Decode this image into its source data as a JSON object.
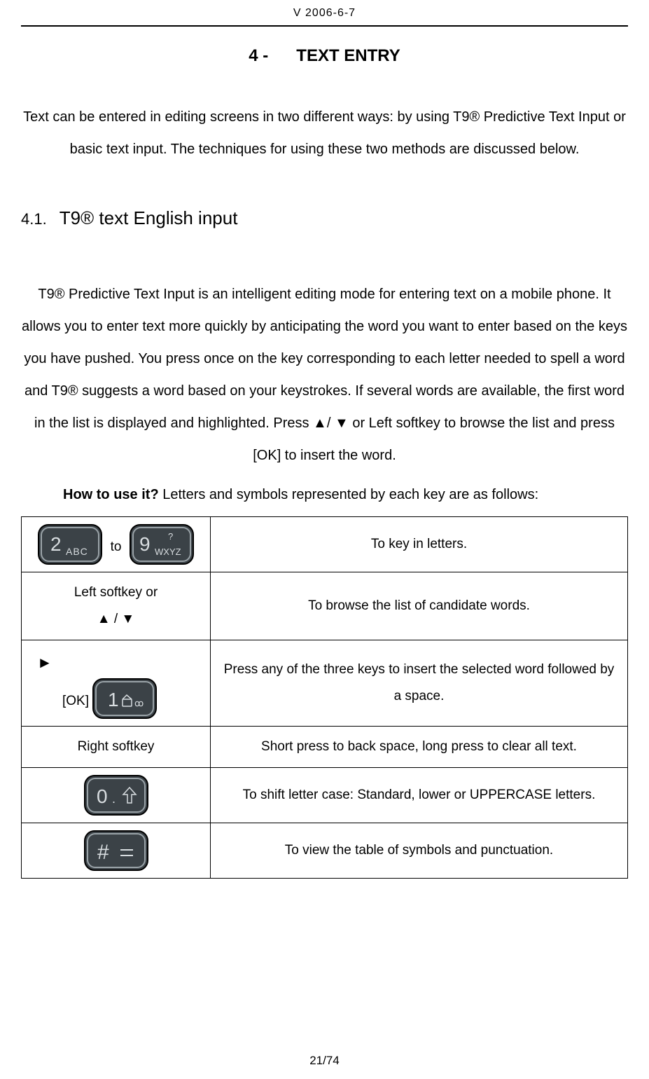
{
  "header": {
    "version": "V 2006-6-7"
  },
  "chapter": {
    "num": "4 -",
    "title": "TEXT ENTRY"
  },
  "intro": "Text can be entered in editing screens in two different ways: by using T9® Predictive Text Input or basic text input. The techniques for using these two methods are discussed below.",
  "section": {
    "num": "4.1.",
    "title": "T9® text English input"
  },
  "body": "T9® Predictive Text Input is an intelligent editing mode for entering text on a mobile phone. It allows you to enter text more quickly by anticipating the word you want to enter based on the keys you have pushed. You press once on the key corresponding to each letter needed to spell a word and T9® suggests a word based on your keystrokes. If several words are available, the first word in the list is displayed and highlighted. Press ▲/ ▼ or Left softkey to browse the list and press [OK] to insert the word.",
  "howto_label": "How to use it?",
  "howto_rest": " Letters and symbols represented by each key are as follows:",
  "table": {
    "rows": [
      {
        "key_between": "to",
        "desc": "To key in letters."
      },
      {
        "key": "Left softkey or\n▲ / ▼",
        "desc": "To browse the list of candidate words."
      },
      {
        "arrow": "►",
        "ok": "[OK]",
        "desc": "Press any of the three keys to insert the selected word followed by a space."
      },
      {
        "key": "Right softkey",
        "desc": "Short press to back space, long press to clear all text."
      },
      {
        "desc": "To shift letter case: Standard, lower or UPPERCASE letters."
      },
      {
        "desc": "To view the table of symbols and punctuation."
      }
    ]
  },
  "footer": {
    "page": "21/74"
  }
}
